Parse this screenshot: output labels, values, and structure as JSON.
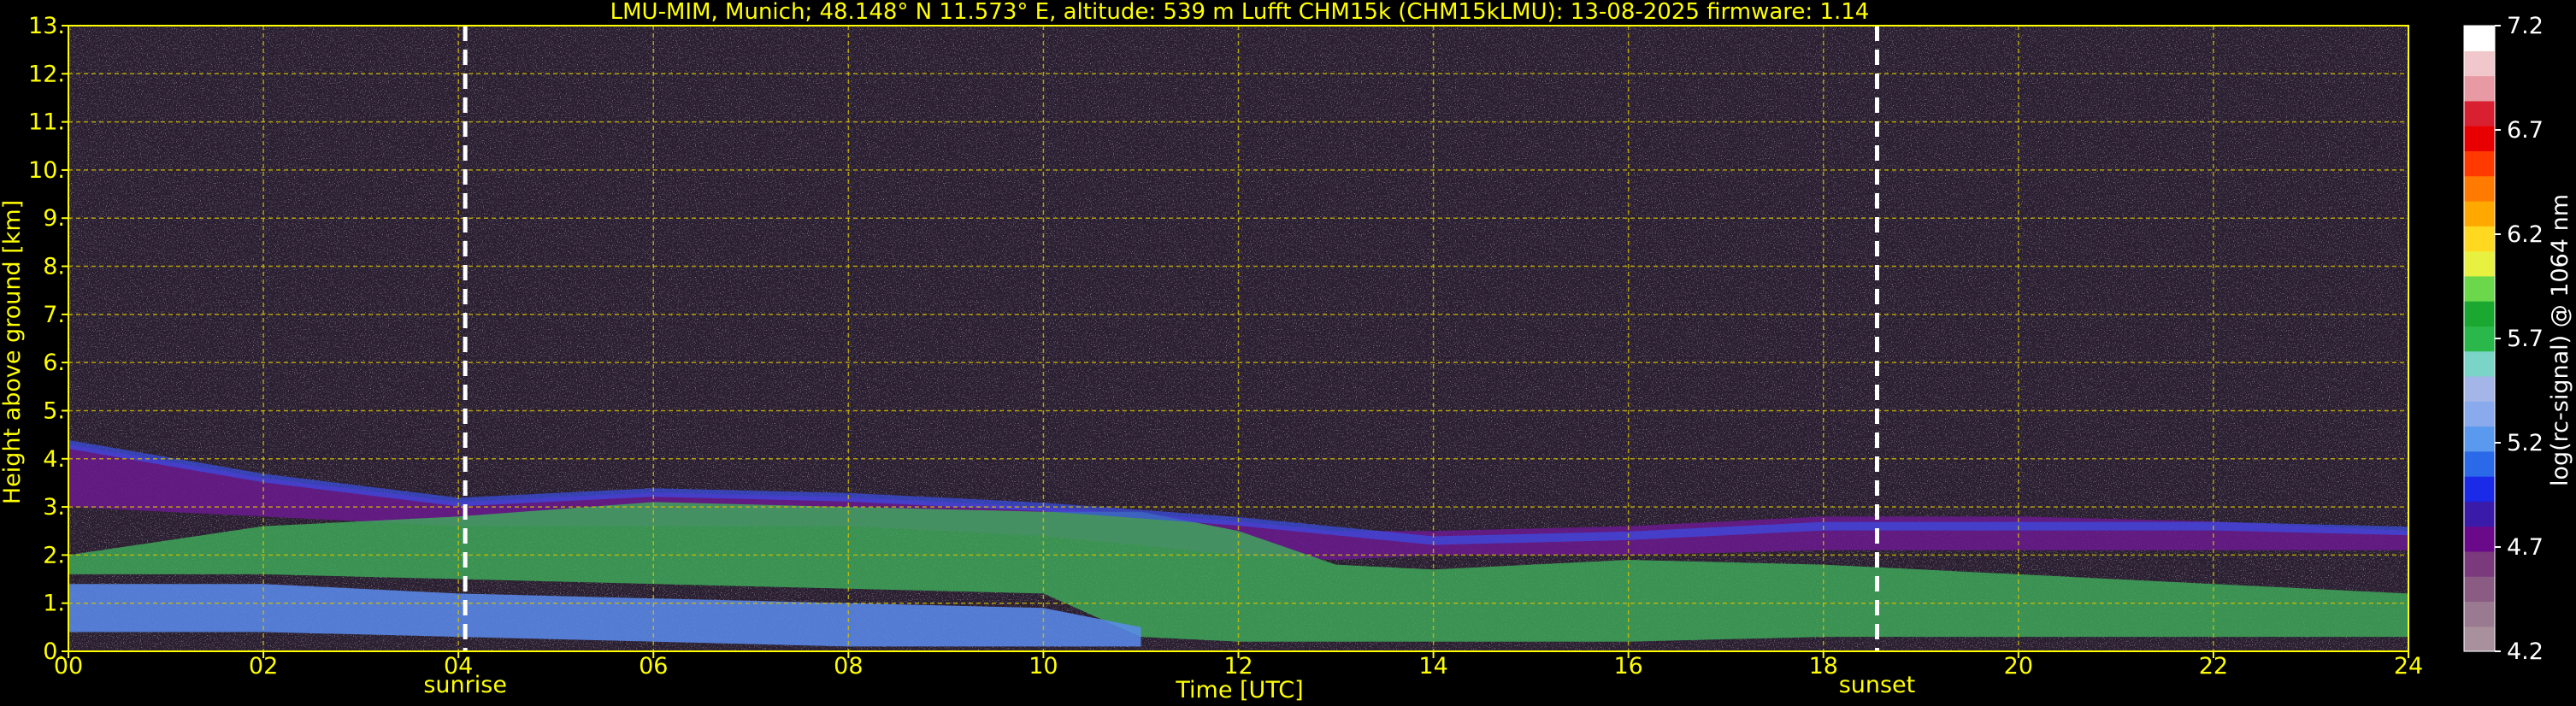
{
  "chart_data": {
    "type": "heatmap",
    "title": "LMU-MIM, Munich; 48.148° N 11.573° E, altitude: 539 m    Lufft CHM15k (CHM15kLMU): 13-08-2025    firmware: 1.14",
    "xlabel": "Time [UTC]",
    "ylabel": "Height above ground [km]",
    "xlim": [
      0,
      24
    ],
    "ylim": [
      0,
      13
    ],
    "x_ticks": [
      "00",
      "02",
      "04",
      "06",
      "08",
      "10",
      "12",
      "14",
      "16",
      "18",
      "20",
      "22",
      "24"
    ],
    "y_ticks": [
      "0.",
      "1.",
      "2.",
      "3.",
      "4.",
      "5.",
      "6.",
      "7.",
      "8.",
      "9.",
      "10.",
      "11.",
      "12.",
      "13."
    ],
    "grid": true,
    "colorbar": {
      "label": "log(rc-signal) @ 1064 nm",
      "range": [
        4.2,
        7.2
      ],
      "ticks": [
        "4.2",
        "4.7",
        "5.2",
        "5.7",
        "6.2",
        "6.7",
        "7.2"
      ],
      "colors": [
        "#a8909c",
        "#9a7a90",
        "#8a5c84",
        "#7a3a7c",
        "#6a0a8a",
        "#3a1aa8",
        "#1a2ae8",
        "#2a6ae8",
        "#5a9aee",
        "#8aaaee",
        "#a4b6e8",
        "#7ad4c8",
        "#2ab84a",
        "#1aa830",
        "#6ad84a",
        "#e8f040",
        "#ffd820",
        "#ffa800",
        "#ff7a00",
        "#ff3a00",
        "#e80000",
        "#d82030",
        "#e89aa4",
        "#f0c8cc",
        "#ffffff"
      ]
    },
    "vertical_markers": [
      {
        "x": 4.07,
        "label": "sunrise"
      },
      {
        "x": 18.55,
        "label": "sunset"
      }
    ],
    "boundary_layer_top": {
      "x": [
        0,
        2,
        4,
        6,
        8,
        10,
        12,
        14,
        16,
        18,
        20,
        22,
        24
      ],
      "y": [
        4.3,
        3.6,
        3.1,
        3.3,
        3.2,
        3.0,
        2.7,
        2.3,
        2.4,
        2.6,
        2.6,
        2.6,
        2.5
      ]
    },
    "bands": [
      {
        "name": "upper-aerosol-layer",
        "x": [
          0,
          2,
          4,
          6,
          8,
          10,
          12,
          13,
          14,
          16,
          18,
          20,
          22,
          24
        ],
        "y_bottom": [
          3.0,
          2.8,
          2.6,
          2.6,
          2.6,
          2.4,
          2.0,
          1.9,
          2.0,
          2.0,
          2.1,
          2.1,
          2.1,
          2.1
        ],
        "y_top": [
          4.3,
          3.6,
          3.1,
          3.3,
          3.2,
          3.0,
          2.7,
          2.5,
          2.5,
          2.6,
          2.8,
          2.8,
          2.7,
          2.5
        ]
      },
      {
        "name": "mixed-layer",
        "x": [
          0,
          2,
          4,
          6,
          8,
          10,
          11,
          12,
          13,
          14,
          16,
          18,
          20,
          22,
          24
        ],
        "y_bottom": [
          1.6,
          1.6,
          1.5,
          1.4,
          1.3,
          1.2,
          0.3,
          0.2,
          0.2,
          0.2,
          0.2,
          0.3,
          0.3,
          0.3,
          0.3
        ],
        "y_top": [
          2.0,
          2.6,
          2.8,
          3.1,
          3.0,
          2.9,
          2.9,
          2.5,
          1.8,
          1.7,
          1.9,
          1.8,
          1.6,
          1.4,
          1.2
        ]
      },
      {
        "name": "nocturnal-residual-layer",
        "x": [
          0,
          2,
          4,
          6,
          8,
          10,
          11
        ],
        "y_bottom": [
          0.4,
          0.4,
          0.3,
          0.2,
          0.1,
          0.1,
          0.1
        ],
        "y_top": [
          1.4,
          1.4,
          1.2,
          1.1,
          1.0,
          0.9,
          0.5
        ]
      }
    ]
  }
}
